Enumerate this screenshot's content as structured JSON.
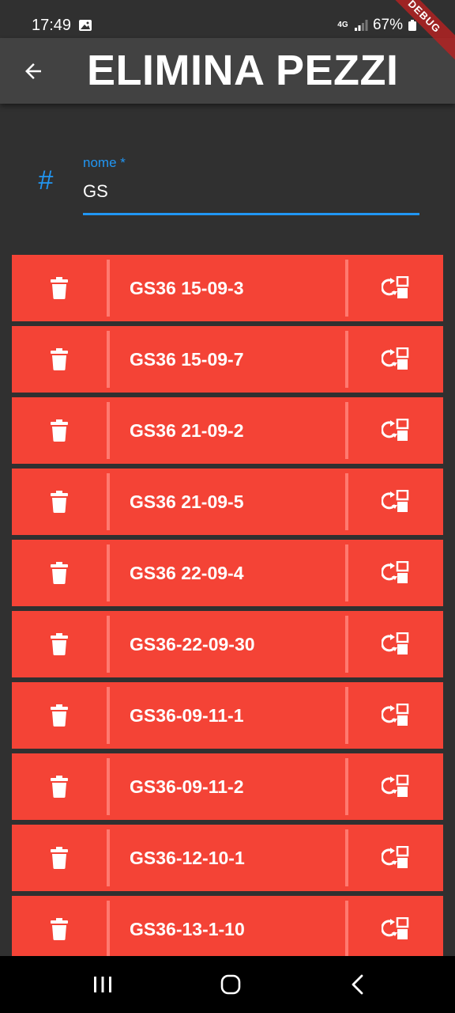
{
  "status_bar": {
    "time": "17:49",
    "network": "4G",
    "battery": "67%",
    "icons": [
      "gallery-icon",
      "signal-icon",
      "battery-icon"
    ]
  },
  "debug_banner": "DEBUG",
  "app_bar": {
    "title": "ELIMINA PEZZI",
    "back_icon": "arrow-back-icon"
  },
  "search": {
    "label": "nome *",
    "value": "GS",
    "icon": "hash-icon",
    "icon_glyph": "#"
  },
  "pieces": [
    {
      "label": "GS36 15-09-3"
    },
    {
      "label": "GS36 15-09-7"
    },
    {
      "label": "GS36 21-09-2"
    },
    {
      "label": "GS36 21-09-5"
    },
    {
      "label": "GS36 22-09-4"
    },
    {
      "label": "GS36-22-09-30"
    },
    {
      "label": "GS36-09-11-1"
    },
    {
      "label": "GS36-09-11-2"
    },
    {
      "label": "GS36-12-10-1"
    },
    {
      "label": "GS36-13-1-10"
    }
  ],
  "row_icons": {
    "left": "trash-icon",
    "right": "swap-layout-icon"
  },
  "colors": {
    "background": "#303030",
    "app_bar": "#424242",
    "accent": "#2196f3",
    "row": "#f44336",
    "row_divider": "#ff7a70"
  },
  "nav_bar": {
    "icons": [
      "recents-icon",
      "home-icon",
      "back-icon"
    ]
  }
}
